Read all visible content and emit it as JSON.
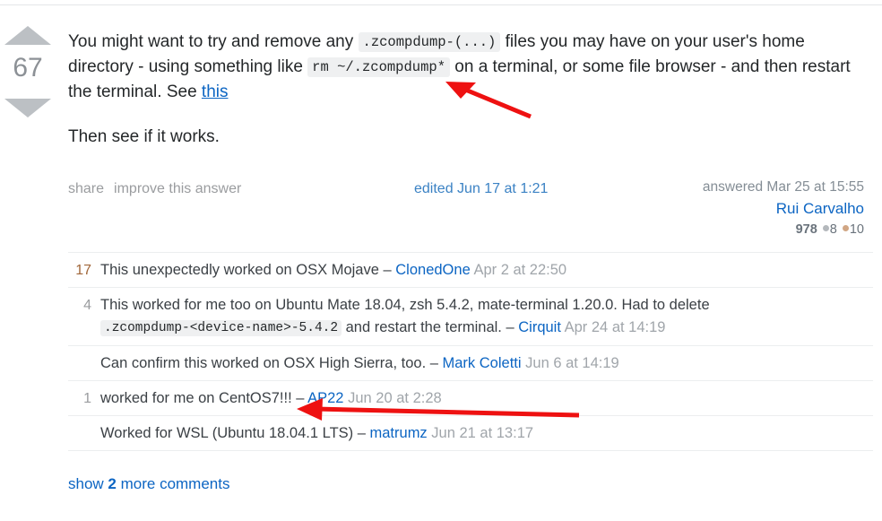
{
  "answer": {
    "vote_score": "67",
    "upvote_icon": "triangle-up-icon",
    "downvote_icon": "triangle-down-icon",
    "body": {
      "p1_part1": "You might want to try and remove any ",
      "p1_code1": ".zcompdump-(...)",
      "p1_part2": " files you may have on your user's home directory - using something like ",
      "p1_code2": "rm ~/.zcompdump*",
      "p1_part3": " on a terminal, or some file browser - and then restart the terminal. See ",
      "p1_link": "this",
      "p2": "Then see if it works."
    },
    "actions": {
      "share": "share",
      "improve": "improve this answer"
    },
    "edited": "edited Jun 17 at 1:21",
    "answered": "answered Mar 25 at 15:55",
    "author": "Rui Carvalho",
    "reputation": "978",
    "silver_badges": "8",
    "bronze_badges": "10"
  },
  "comments": [
    {
      "score": "17",
      "score_highlight": true,
      "text": "This unexpectedly worked on OSX Mojave",
      "dash": " – ",
      "user": "ClonedOne",
      "date": "Apr 2 at 22:50",
      "code_before": "",
      "code": "",
      "code_after": ""
    },
    {
      "score": "4",
      "score_highlight": false,
      "text": "This worked for me too on Ubuntu Mate 18.04, zsh 5.4.2, mate-terminal 1.20.0. Had to delete ",
      "code": ".zcompdump-<device-name>-5.4.2",
      "code_after": " and restart the terminal.",
      "dash": " – ",
      "user": "Cirquit",
      "date": "Apr 24 at 14:19"
    },
    {
      "score": "",
      "score_highlight": false,
      "text": "Can confirm this worked on OSX High Sierra, too.",
      "dash": " – ",
      "user": "Mark Coletti",
      "date": "Jun 6 at 14:19",
      "code": "",
      "code_after": ""
    },
    {
      "score": "1",
      "score_highlight": false,
      "text": "worked for me on CentOS7!!!",
      "dash": " – ",
      "user": "AP22",
      "date": "Jun 20 at 2:28",
      "code": "",
      "code_after": ""
    },
    {
      "score": "",
      "score_highlight": false,
      "text": "Worked for WSL (Ubuntu 18.04.1 LTS)",
      "dash": " – ",
      "user": "matrumz",
      "date": "Jun 21 at 13:17",
      "code": "",
      "code_after": ""
    }
  ],
  "show_more": {
    "prefix": "show ",
    "count": "2",
    "suffix": " more comments"
  },
  "annotations": {
    "arrow_color": "#ee1111",
    "arrow1_label": "red-arrow-pointing-to-rm-command",
    "arrow2_label": "red-arrow-pointing-to-centos-comment"
  },
  "colors": {
    "link": "#0c65c3",
    "text": "#242729",
    "muted": "#9a9c9f",
    "code_bg": "#eff0f1",
    "bronze": "#d1a684",
    "silver": "#b4b8bc",
    "hot_score": "#a1673a"
  }
}
